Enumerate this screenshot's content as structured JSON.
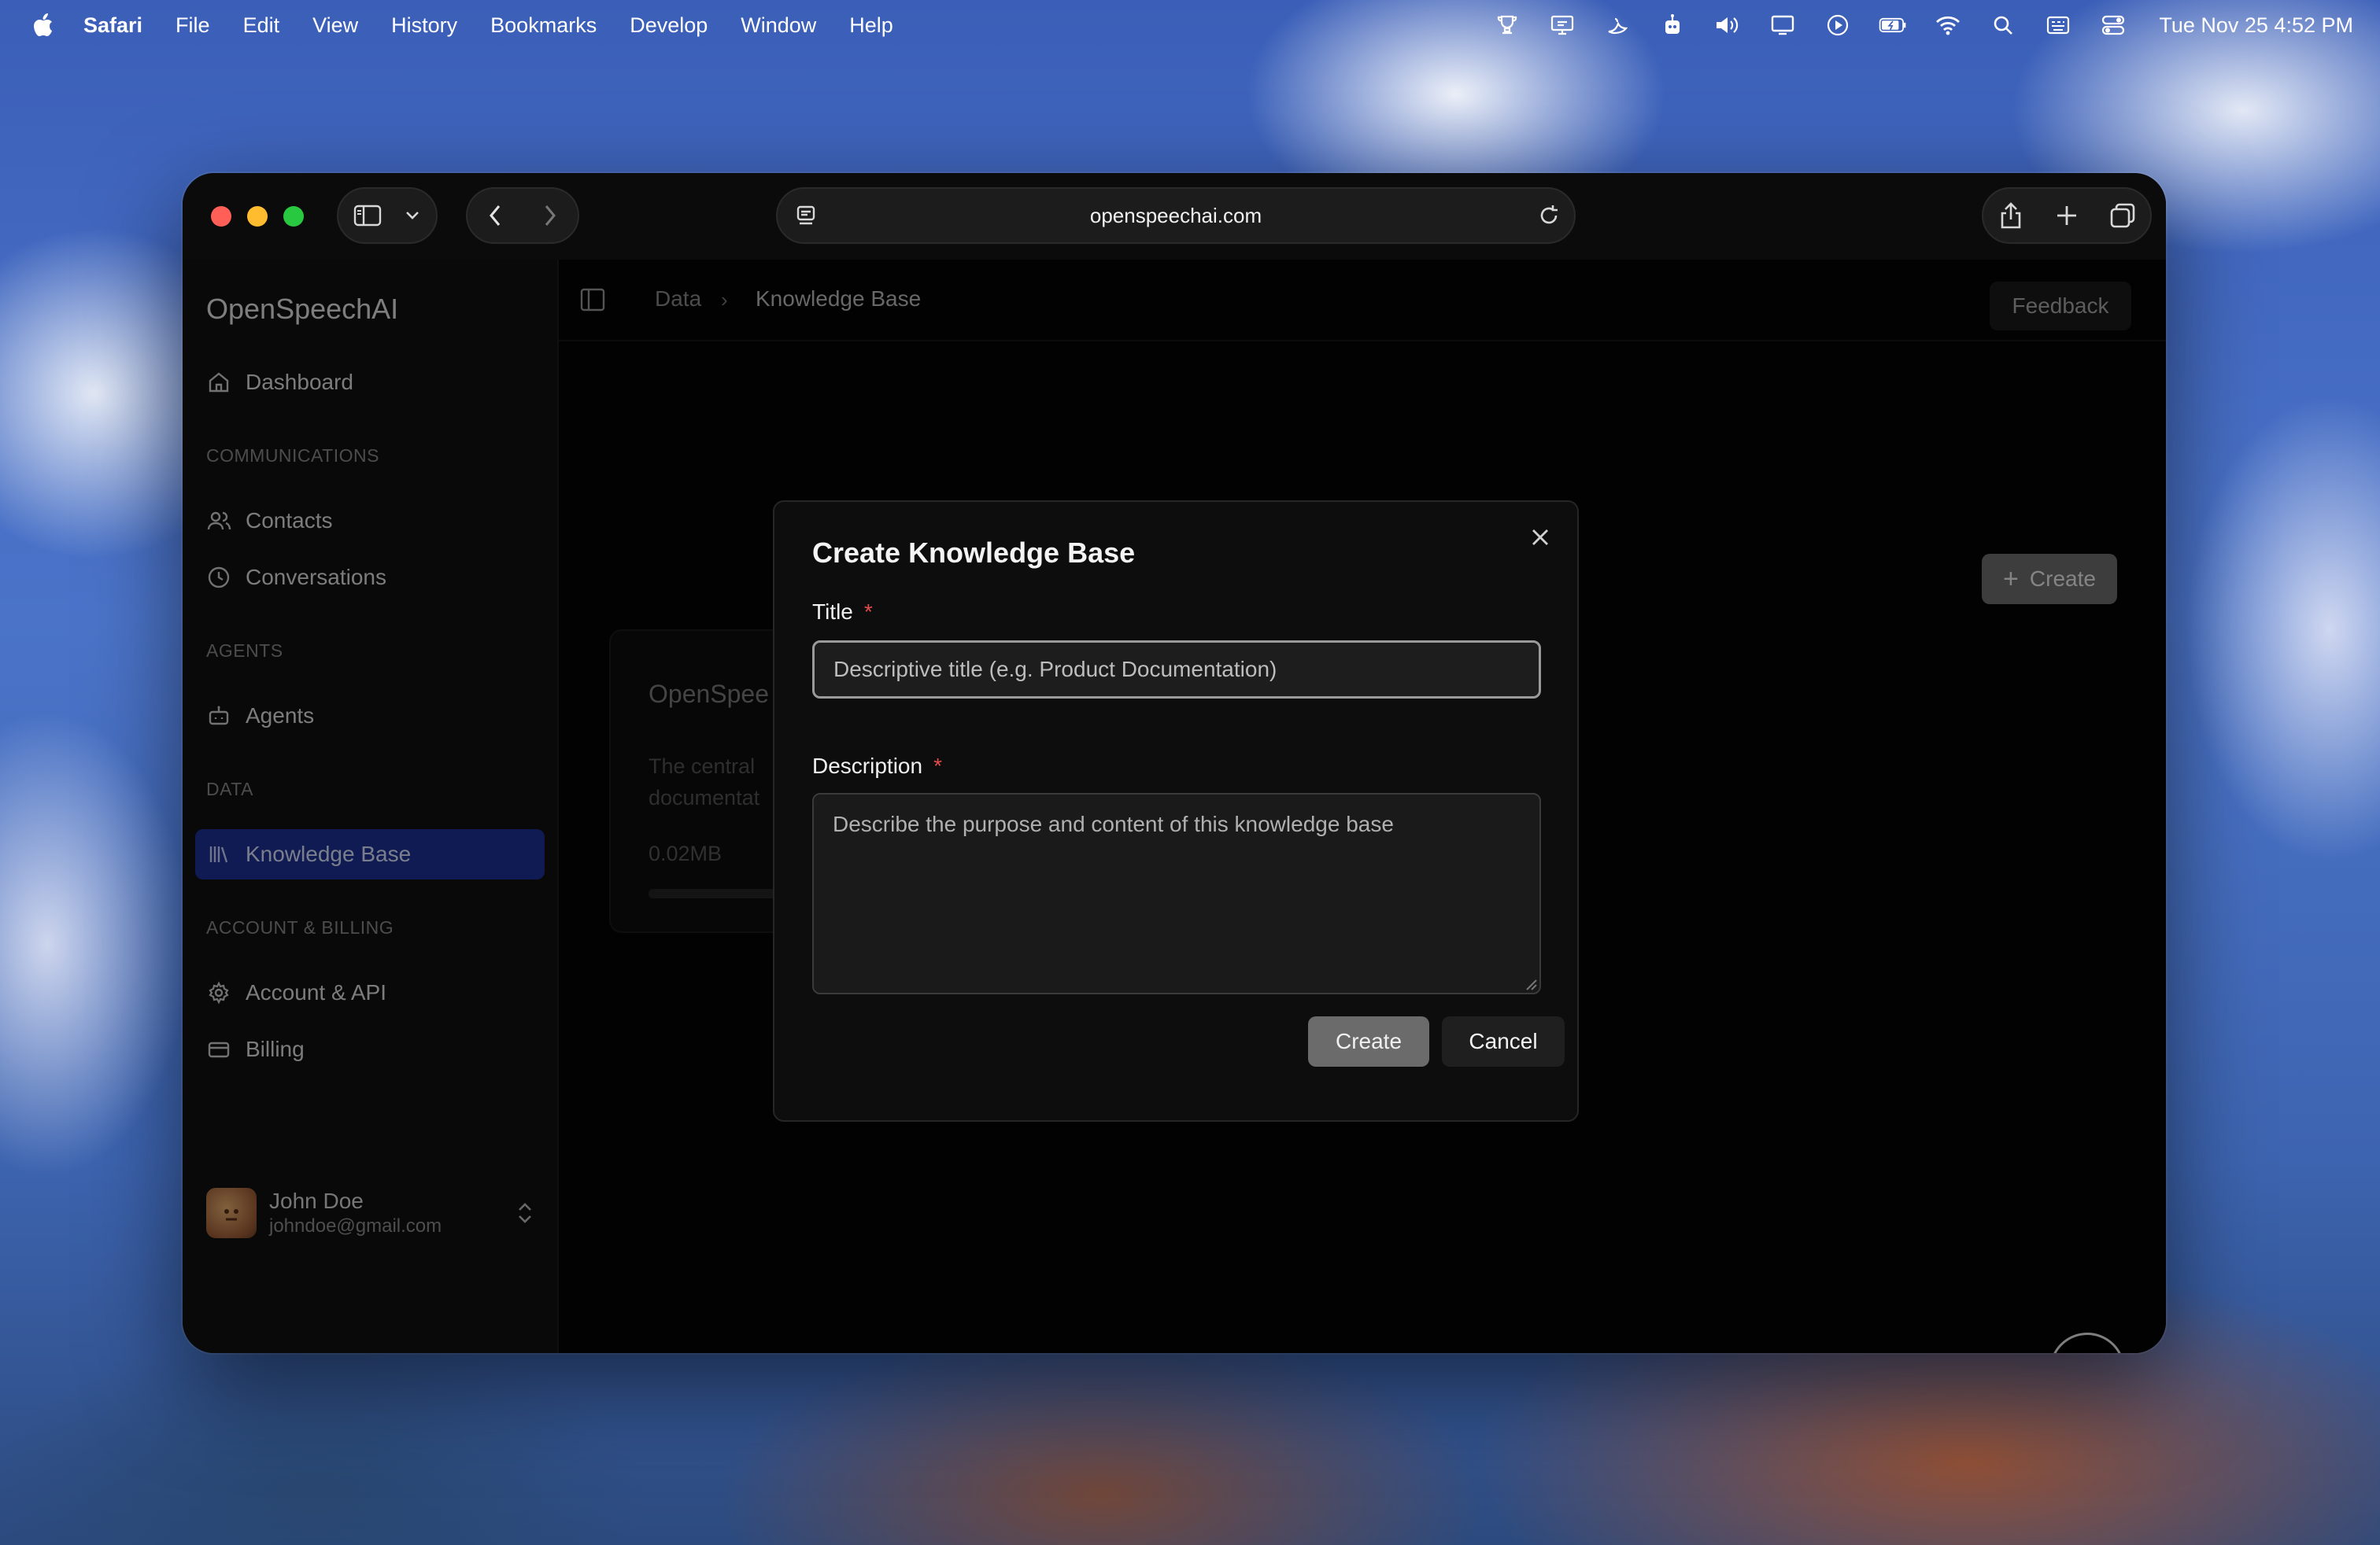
{
  "menubar": {
    "app": "Safari",
    "items": [
      "File",
      "Edit",
      "View",
      "History",
      "Bookmarks",
      "Develop",
      "Window",
      "Help"
    ],
    "clock": "Tue Nov 25  4:52 PM"
  },
  "browser": {
    "url": "openspeechai.com"
  },
  "sidebar": {
    "brand": "OpenSpeechAI",
    "dashboard": "Dashboard",
    "sections": {
      "communications": "COMMUNICATIONS",
      "agents": "AGENTS",
      "data": "DATA",
      "account": "ACCOUNT & BILLING"
    },
    "items": {
      "contacts": "Contacts",
      "conversations": "Conversations",
      "agents": "Agents",
      "knowledge_base": "Knowledge Base",
      "account_api": "Account & API",
      "billing": "Billing"
    },
    "user": {
      "name": "John Doe",
      "email": "johndoe@gmail.com"
    }
  },
  "header": {
    "breadcrumb_data": "Data",
    "breadcrumb_sep": "›",
    "breadcrumb_current": "Knowledge Base",
    "feedback": "Feedback"
  },
  "main": {
    "create_label": "Create",
    "card": {
      "title": "OpenSpee",
      "description_line1": "The central",
      "description_line2": "documentat",
      "size": "0.02MB"
    }
  },
  "modal": {
    "title": "Create Knowledge Base",
    "title_label": "Title",
    "required_mark": "*",
    "title_placeholder": "Descriptive title (e.g. Product Documentation)",
    "description_label": "Description",
    "description_placeholder": "Describe the purpose and content of this knowledge base",
    "create_button": "Create",
    "cancel_button": "Cancel"
  },
  "colors": {
    "accent_active_nav": "#1c3296",
    "required": "#e44b4b",
    "traffic_red": "#ff5f57",
    "traffic_yellow": "#febc2e",
    "traffic_green": "#28c840"
  }
}
